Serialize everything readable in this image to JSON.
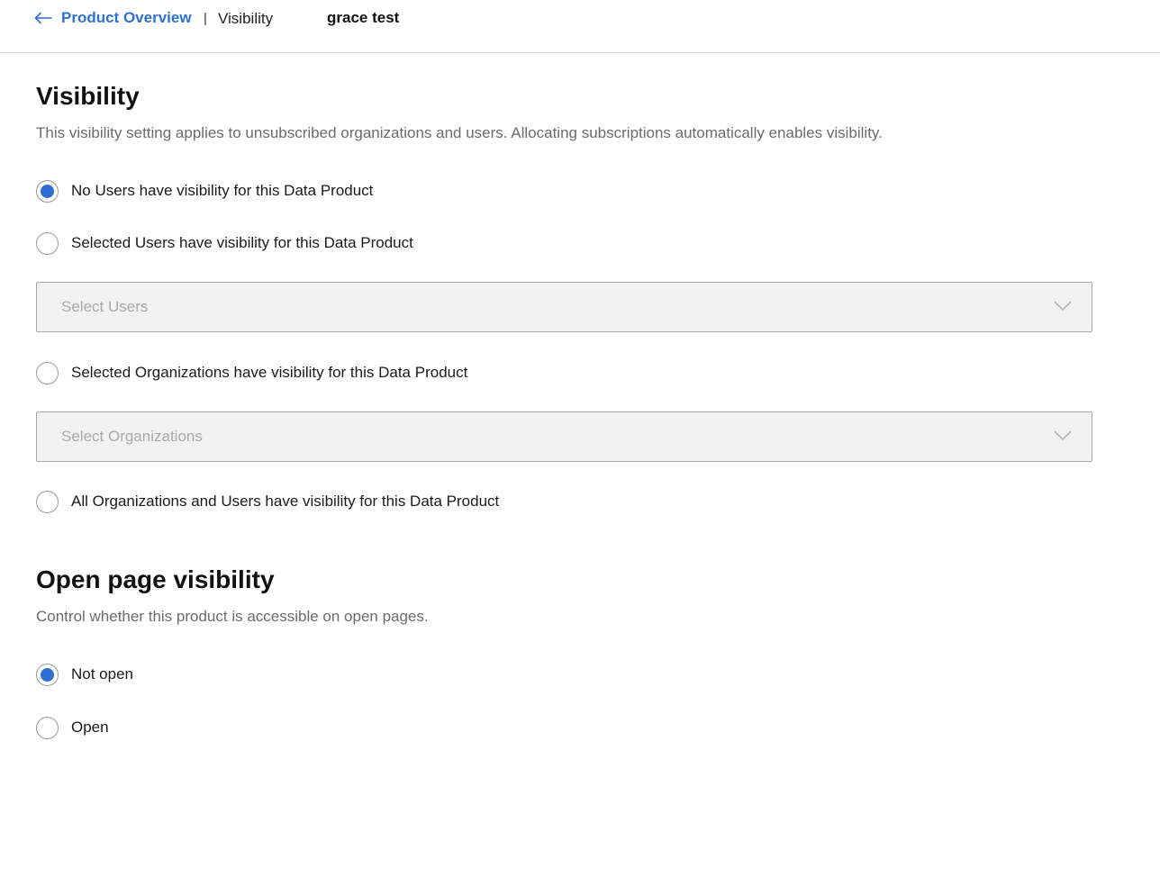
{
  "header": {
    "back_label": "Product Overview",
    "separator": "|",
    "current_page": "Visibility",
    "product_name": "grace test"
  },
  "visibility": {
    "title": "Visibility",
    "description": "This visibility setting applies to unsubscribed organizations and users. Allocating subscriptions automatically enables visibility.",
    "options": [
      {
        "label": "No Users have visibility for this Data Product",
        "selected": true
      },
      {
        "label": "Selected Users have visibility for this Data Product",
        "selected": false
      },
      {
        "label": "Selected Organizations have visibility for this Data Product",
        "selected": false
      },
      {
        "label": "All Organizations and Users have visibility for this Data Product",
        "selected": false
      }
    ],
    "users_select": {
      "placeholder": "Select Users"
    },
    "orgs_select": {
      "placeholder": "Select Organizations"
    }
  },
  "open_page": {
    "title": "Open page visibility",
    "description": "Control whether this product is accessible on open pages.",
    "options": [
      {
        "label": "Not open",
        "selected": true
      },
      {
        "label": "Open",
        "selected": false
      }
    ]
  },
  "colors": {
    "accent": "#2f6fd3",
    "muted_text": "#6b6b6b",
    "select_bg": "#f2f2f2"
  }
}
